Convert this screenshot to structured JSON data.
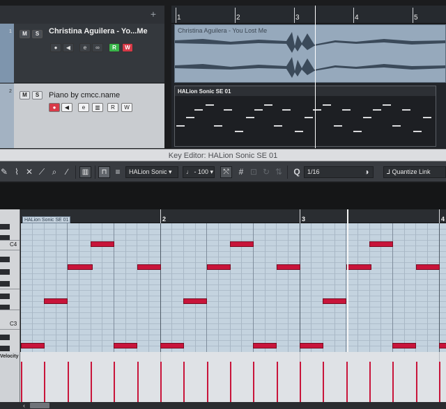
{
  "project": {
    "add_track_symbol": "+",
    "tracks": [
      {
        "number": "1",
        "name": "Christina Aguilera - Yo...Me",
        "mute": "M",
        "solo": "S",
        "controls": [
          "●",
          "◀",
          "e",
          "∞",
          "R",
          "W"
        ]
      },
      {
        "number": "2",
        "name": "Piano by cmcc.name",
        "mute": "M",
        "solo": "S",
        "controls": [
          "●",
          "◀",
          "e",
          "▥",
          "R",
          "W"
        ]
      }
    ],
    "ruler": [
      "1",
      "2",
      "3",
      "4",
      "5"
    ],
    "audio_event_title": "Christina Aguilera - You Lost Me",
    "midi_event_title": "HALion Sonic SE 01"
  },
  "key_editor": {
    "window_title": "Key Editor: HALion Sonic SE 01",
    "toolbar": {
      "instrument": "HALion Sonic",
      "velocity_value": "100",
      "quantize": "1/16",
      "quantize_link": "Quantize Link"
    },
    "part_label": "HALion Sonic SE 01",
    "ruler": [
      "2",
      "3",
      "4"
    ],
    "key_labels": [
      "C4",
      "C3"
    ],
    "velocity_label": "Velocity"
  },
  "colors": {
    "note": "#c8143a",
    "grid_bg": "#c4d3df",
    "audio_event": "#96a9bc"
  }
}
